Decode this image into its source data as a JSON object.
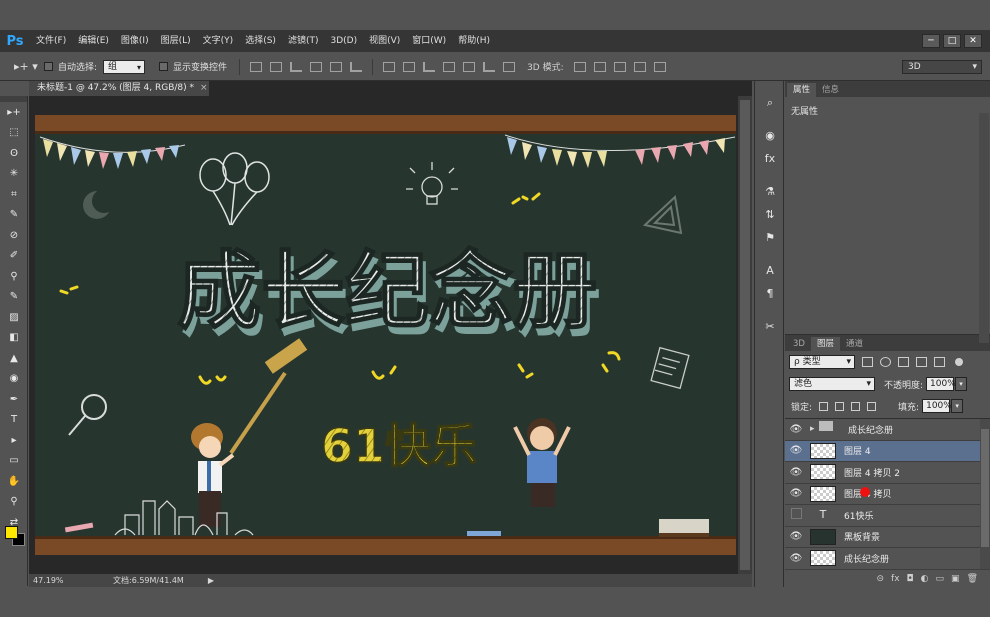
{
  "app": {
    "logo": "Ps"
  },
  "menu": [
    "文件(F)",
    "编辑(E)",
    "图像(I)",
    "图层(L)",
    "文字(Y)",
    "选择(S)",
    "滤镜(T)",
    "3D(D)",
    "视图(V)",
    "窗口(W)",
    "帮助(H)"
  ],
  "window_buttons": [
    "─",
    "□",
    "✕"
  ],
  "options": {
    "auto_select_label": "自动选择:",
    "auto_select_value": "组",
    "transform_label": "显示变换控件",
    "mode3d_label": "3D 模式:",
    "workspace": "3D"
  },
  "document": {
    "tab_title": "未标题-1 @ 47.2% (图层 4, RGB/8) *",
    "tab_close": "×",
    "zoom": "47.19%",
    "doc_size": "文档:6.59M/41.4M",
    "status_arrow": "▶"
  },
  "artwork": {
    "title": "成长纪念册",
    "subtitle": "61快乐"
  },
  "tools": [
    "▸+",
    "⬚",
    "ʘ",
    "✳",
    "⌗",
    "✎",
    "⊘",
    "✐",
    "⚲",
    "✎",
    "▨",
    "◧",
    "▲",
    "◉",
    "✒",
    "T",
    "▸",
    "▭",
    "✋",
    "⚲",
    "⇄"
  ],
  "icon_column": [
    "⌕",
    "◉",
    "fx",
    "⚗",
    "⇅",
    "⚑",
    "A",
    "¶",
    "✂"
  ],
  "properties": {
    "tabs": [
      "属性",
      "信息"
    ],
    "empty_text": "无属性"
  },
  "layers_panel": {
    "tabs": [
      "3D",
      "图层",
      "通道"
    ],
    "kind_label": "ρ 类型",
    "blend_mode": "滤色",
    "opacity_label": "不透明度:",
    "opacity_value": "100%",
    "lock_label": "锁定:",
    "fill_label": "填充:",
    "fill_value": "100%",
    "layers": [
      {
        "name": "成长纪念册",
        "type": "group",
        "visible": true,
        "selected": false
      },
      {
        "name": "图层 4",
        "type": "pixel",
        "visible": true,
        "selected": true
      },
      {
        "name": "图层 4 拷贝 2",
        "type": "pixel",
        "visible": true,
        "selected": false
      },
      {
        "name": "图层 4 拷贝",
        "type": "pixel",
        "visible": true,
        "selected": false
      },
      {
        "name": "61快乐",
        "type": "text",
        "visible": false,
        "selected": false
      },
      {
        "name": "黑板背景",
        "type": "image",
        "visible": true,
        "selected": false
      },
      {
        "name": "成长纪念册",
        "type": "image-text",
        "visible": true,
        "selected": false
      }
    ],
    "footer_icons": [
      "⊝",
      "fx",
      "◘",
      "◐",
      "▭",
      "▣",
      "🗑"
    ]
  },
  "colors": {
    "foreground": "#ffe800",
    "background": "#000000",
    "chalkboard": "#27352f",
    "wood": "#7a4a26",
    "selection": "#5b6f8e"
  }
}
